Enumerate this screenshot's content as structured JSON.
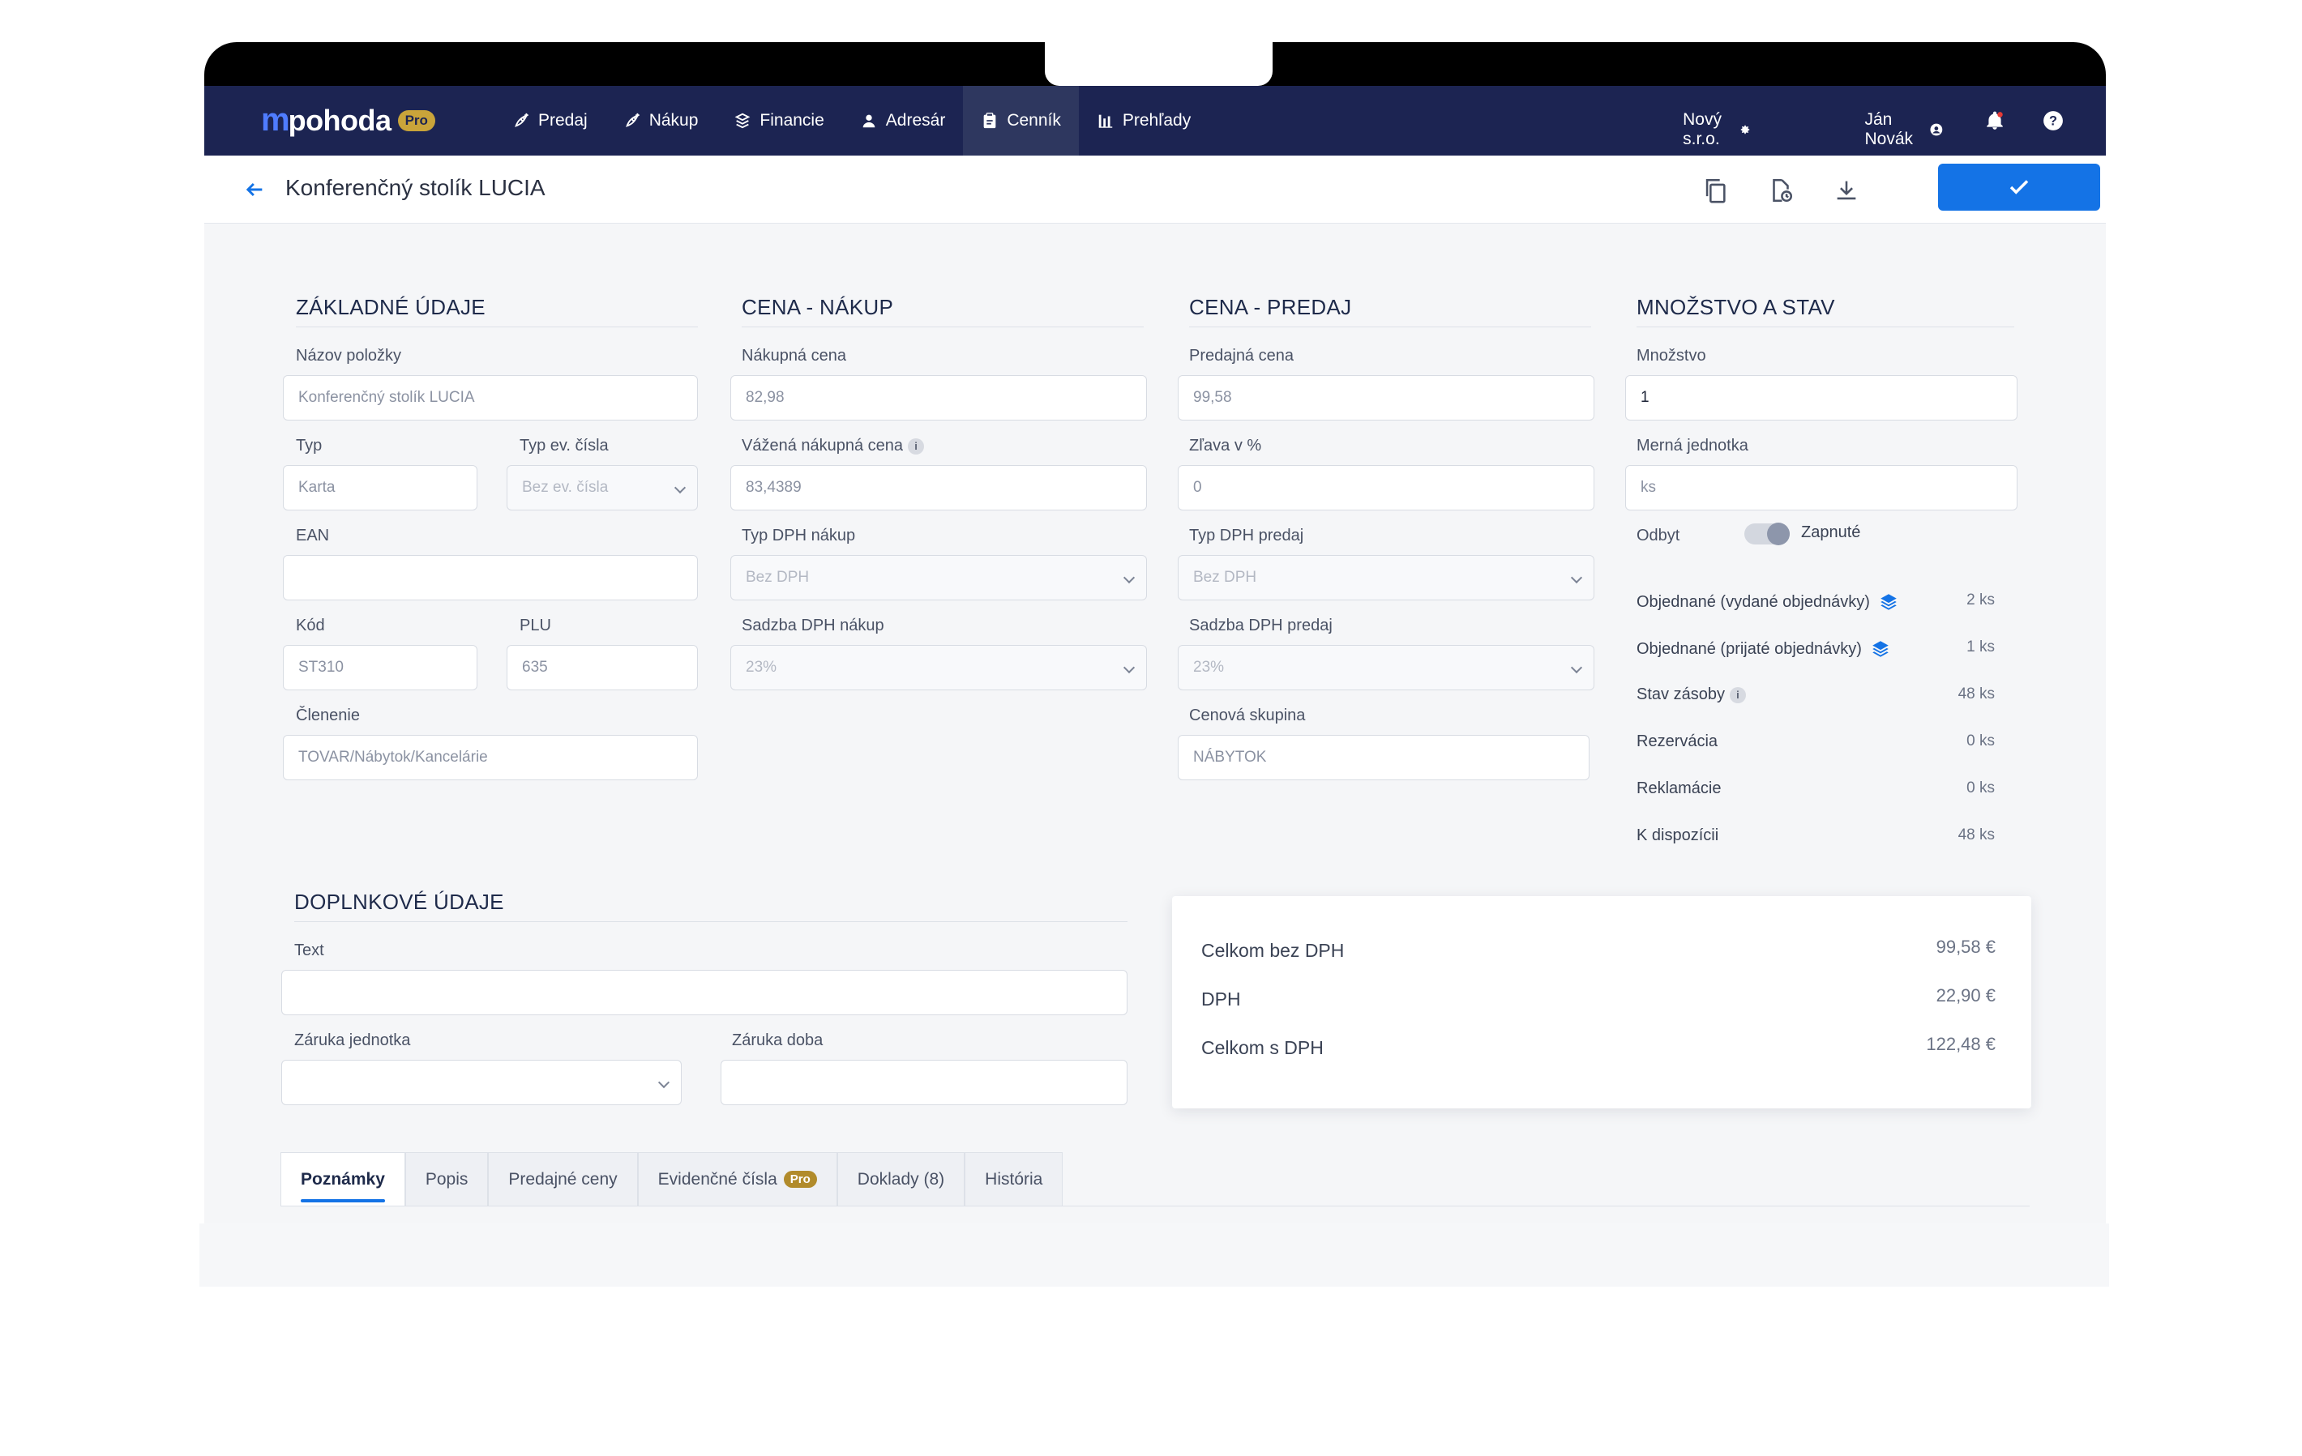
{
  "nav": {
    "logo_mark": "m",
    "logo_text": "pohoda",
    "logo_badge": "Pro",
    "items": [
      {
        "label": "Predaj",
        "icon": "rocket-icon"
      },
      {
        "label": "Nákup",
        "icon": "rocket-icon"
      },
      {
        "label": "Financie",
        "icon": "coins-icon"
      },
      {
        "label": "Adresár",
        "icon": "user-icon"
      },
      {
        "label": "Cenník",
        "icon": "clipboard-icon",
        "active": true
      },
      {
        "label": "Prehľady",
        "icon": "bar-chart-icon"
      }
    ],
    "company": "Nový s.r.o.",
    "user": "Ján Novák"
  },
  "title": "Konferenčný stolík LUCIA",
  "basic": {
    "title": "ZÁKLADNÉ ÚDAJE",
    "name_label": "Názov položky",
    "name_value": "Konferenčný stolík LUCIA",
    "type_label": "Typ",
    "type_value": "Karta",
    "evtype_label": "Typ ev. čísla",
    "evtype_value": "Bez ev. čísla",
    "ean_label": "EAN",
    "ean_value": "",
    "code_label": "Kód",
    "code_value": "ST310",
    "plu_label": "PLU",
    "plu_value": "635",
    "cat_label": "Členenie",
    "cat_value": "TOVAR/Nábytok/Kancelárie"
  },
  "purchase": {
    "title": "CENA - NÁKUP",
    "price_label": "Nákupná cena",
    "price_value": "82,98",
    "wprice_label": "Vážená nákupná cena",
    "wprice_value": "83,4389",
    "vattype_label": "Typ DPH nákup",
    "vattype_value": "Bez DPH",
    "vatrate_label": "Sadzba DPH nákup",
    "vatrate_value": "23%"
  },
  "sale": {
    "title": "CENA - PREDAJ",
    "price_label": "Predajná cena",
    "price_value": "99,58",
    "discount_label": "Zľava v %",
    "discount_value": "0",
    "vattype_label": "Typ DPH predaj",
    "vattype_value": "Bez DPH",
    "vatrate_label": "Sadzba DPH predaj",
    "vatrate_value": "23%",
    "group_label": "Cenová skupina",
    "group_value": "NÁBYTOK"
  },
  "stock": {
    "title": "MNOŽSTVO A STAV",
    "qty_label": "Množstvo",
    "qty_value": "1",
    "unit_label": "Merná jednotka",
    "unit_value": "ks",
    "sale_label": "Odbyt",
    "sale_toggle_label": "Zapnuté",
    "rows": [
      {
        "label": "Objednané (vydané objednávky)",
        "value": "2 ks"
      },
      {
        "label": "Objednané (prijaté objednávky)",
        "value": "1 ks"
      },
      {
        "label": "Stav zásoby",
        "value": "48 ks"
      },
      {
        "label": "Rezervácia",
        "value": "0 ks"
      },
      {
        "label": "Reklamácie",
        "value": "0 ks"
      },
      {
        "label": "K dispozícii",
        "value": "48 ks"
      }
    ]
  },
  "extra": {
    "title": "DOPLNKOVÉ ÚDAJE",
    "text_label": "Text",
    "text_value": "",
    "warranty_unit_label": "Záruka jednotka",
    "warranty_unit_value": "",
    "warranty_period_label": "Záruka doba",
    "warranty_period_value": ""
  },
  "summary": {
    "rows": [
      {
        "label": "Celkom bez DPH",
        "value": "99,58 €"
      },
      {
        "label": "DPH",
        "value": "22,90 €"
      },
      {
        "label": "Celkom s DPH",
        "value": "122,48 €"
      }
    ]
  },
  "tabs": [
    {
      "label": "Poznámky",
      "active": true
    },
    {
      "label": "Popis"
    },
    {
      "label": "Predajné ceny"
    },
    {
      "label": "Evidenčné čísla",
      "badge": "Pro"
    },
    {
      "label": "Doklady (8)"
    },
    {
      "label": "História"
    }
  ],
  "colors": {
    "nav_bg": "#1c2452",
    "accent": "#1473e6",
    "pro_badge": "#c9a43a"
  }
}
